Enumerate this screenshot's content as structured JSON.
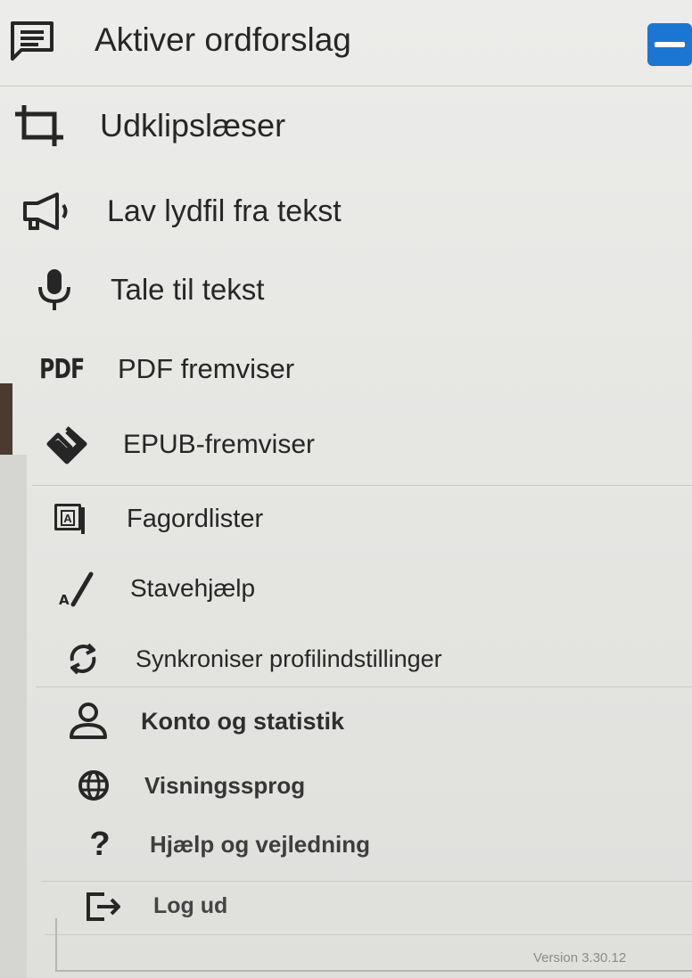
{
  "menu": {
    "items": [
      {
        "label": "Aktiver ordforslag",
        "icon": "word-suggestions-icon"
      },
      {
        "label": "Udklipslæser",
        "icon": "crop-icon"
      },
      {
        "label": "Lav lydfil fra tekst",
        "icon": "megaphone-icon"
      },
      {
        "label": "Tale til tekst",
        "icon": "microphone-icon"
      },
      {
        "label": "PDF fremviser",
        "icon": "pdf-icon",
        "icon_text": "PDF"
      },
      {
        "label": "EPUB-fremviser",
        "icon": "epub-icon"
      },
      {
        "label": "Fagordlister",
        "icon": "dictionary-icon",
        "icon_text": "A"
      },
      {
        "label": "Stavehjælp",
        "icon": "spelling-icon",
        "icon_text": "A"
      },
      {
        "label": "Synkroniser profilindstillinger",
        "icon": "sync-icon"
      },
      {
        "label": "Konto og statistik",
        "icon": "person-icon"
      },
      {
        "label": "Visningssprog",
        "icon": "globe-icon"
      },
      {
        "label": "Hjælp og vejledning",
        "icon": "help-icon",
        "icon_text": "?"
      },
      {
        "label": "Log ud",
        "icon": "logout-icon"
      }
    ]
  },
  "toggle": {
    "state": "on",
    "color": "#1a76d2"
  },
  "version": "Version 3.30.12"
}
